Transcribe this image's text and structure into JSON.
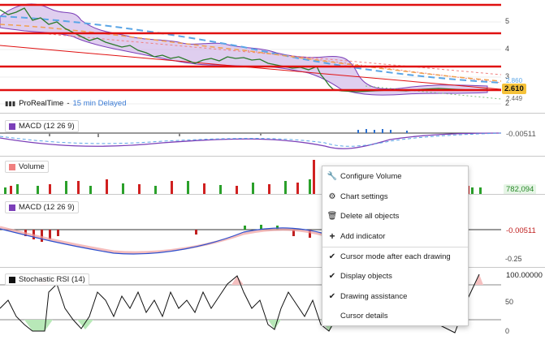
{
  "price_axis": {
    "labels": [
      "5",
      "4",
      "3",
      "2"
    ],
    "current_price": "2.610",
    "overlap_top": "2.860",
    "overlap_bottom": "2.449"
  },
  "source": {
    "name": "ProRealTime",
    "sep": "-",
    "delay": "15 min Delayed"
  },
  "panels": [
    {
      "id": "macd1",
      "title": "MACD (12 26 9)",
      "value": "-0.00511"
    },
    {
      "id": "volume",
      "title": "Volume",
      "value": "782,094"
    },
    {
      "id": "macd2",
      "title": "MACD (12 26 9)",
      "value": "-0.00511",
      "axis": "-0.25"
    },
    {
      "id": "stoch",
      "title": "Stochastic RSI (14)",
      "value": "100.00000",
      "axis": [
        "50",
        "0"
      ]
    }
  ],
  "context_menu": {
    "items": [
      {
        "label": "Configure Volume",
        "icon": "wrench-icon",
        "glyph": "🔧"
      },
      {
        "label": "Chart settings",
        "icon": "chart-settings-icon",
        "glyph": "⚙"
      },
      {
        "label": "Delete all objects",
        "icon": "trash-icon",
        "glyph": "🗑"
      },
      {
        "label": "Add indicator",
        "icon": "plus-icon",
        "glyph": "+"
      },
      {
        "label": "Cursor mode after each drawing",
        "icon": "check-icon",
        "glyph": "✔"
      },
      {
        "label": "Display objects",
        "icon": "check-icon",
        "glyph": "✔"
      },
      {
        "label": "Drawing assistance",
        "icon": "check-icon",
        "glyph": "✔"
      },
      {
        "label": "Cursor details",
        "icon": "",
        "glyph": ""
      }
    ]
  },
  "colors": {
    "support_line": "#e01010",
    "bollinger_fill": "#b48bd6",
    "up": "#2aa02a",
    "down": "#d02020",
    "current": "#f5c23a"
  }
}
